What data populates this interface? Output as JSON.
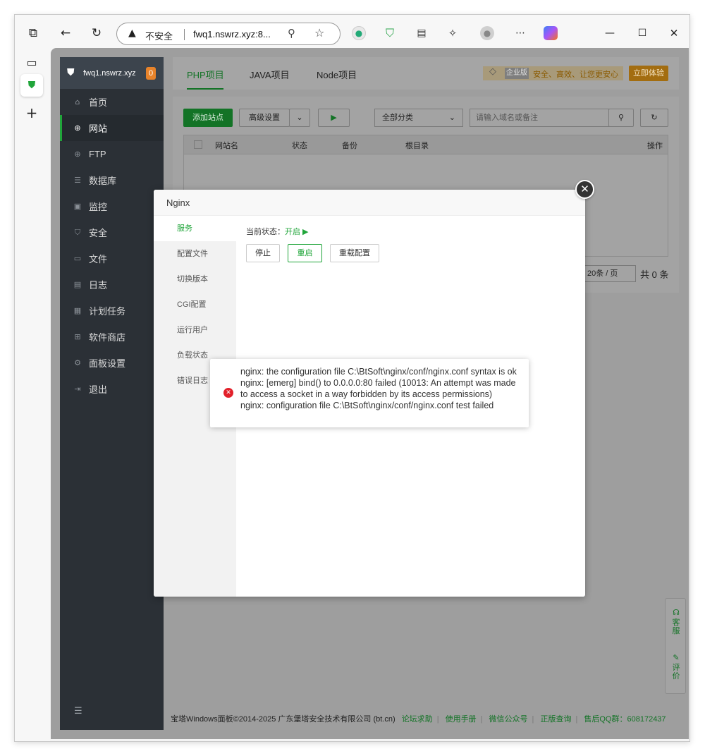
{
  "browser": {
    "address": {
      "insecure_label": "不安全",
      "url": "fwq1.nswrz.xyz:8..."
    },
    "icons": [
      "tab-actions-icon",
      "back-icon",
      "refresh-icon",
      "warning-icon",
      "zoom-icon",
      "favorite-star-icon",
      "extension-icon",
      "shield-extension-icon",
      "collections-icon",
      "extensions-icon",
      "profile-icon",
      "more-icon",
      "copilot-icon",
      "minimize-icon",
      "maximize-icon",
      "close-icon"
    ]
  },
  "sidebar": {
    "host": "fwq1.nswrz.xyz",
    "badge": "0",
    "items": [
      {
        "label": "首页",
        "icon": "home-icon"
      },
      {
        "label": "网站",
        "icon": "globe-icon"
      },
      {
        "label": "FTP",
        "icon": "ftp-icon"
      },
      {
        "label": "数据库",
        "icon": "database-icon"
      },
      {
        "label": "监控",
        "icon": "monitor-icon"
      },
      {
        "label": "安全",
        "icon": "security-icon"
      },
      {
        "label": "文件",
        "icon": "folder-icon"
      },
      {
        "label": "日志",
        "icon": "log-icon"
      },
      {
        "label": "计划任务",
        "icon": "calendar-icon"
      },
      {
        "label": "软件商店",
        "icon": "store-icon"
      },
      {
        "label": "面板设置",
        "icon": "settings-icon"
      },
      {
        "label": "退出",
        "icon": "logout-icon"
      }
    ]
  },
  "tabs": [
    "PHP项目",
    "JAVA项目",
    "Node项目"
  ],
  "enterprise": {
    "tag": "企业版",
    "text": "安全、高效、让您更安心",
    "button": "立即体验"
  },
  "toolbar": {
    "add_site": "添加站点",
    "advanced": "高级设置",
    "category": "全部分类",
    "search_placeholder": "请输入域名或备注"
  },
  "table": {
    "headers": [
      "网站名",
      "状态",
      "备份",
      "根目录",
      "操作"
    ]
  },
  "pager": {
    "per_page": "20条 / 页",
    "total": "共 0 条"
  },
  "footer": {
    "copyright": "宝塔Windows面板©2014-2025 广东堡塔安全技术有限公司 (bt.cn)",
    "links": [
      "论坛求助",
      "使用手册",
      "微信公众号",
      "正版查询",
      "售后QQ群：608172437"
    ]
  },
  "float_side": {
    "service": "客服",
    "review": "评价"
  },
  "modal": {
    "title": "Nginx",
    "nav": [
      "服务",
      "配置文件",
      "切换版本",
      "CGI配置",
      "运行用户",
      "负载状态",
      "错误日志"
    ],
    "status_label": "当前状态：",
    "status_value": "开启 ▶",
    "buttons": [
      "停止",
      "重启",
      "重载配置"
    ]
  },
  "toast": {
    "message": "nginx: the configuration file C:\\BtSoft\\nginx/conf/nginx.conf syntax is ok nginx: [emerg] bind() to 0.0.0.0:80 failed (10013: An attempt was made to access a socket in a way forbidden by its access permissions) nginx: configuration file C:\\BtSoft\\nginx/conf/nginx.conf test failed"
  }
}
